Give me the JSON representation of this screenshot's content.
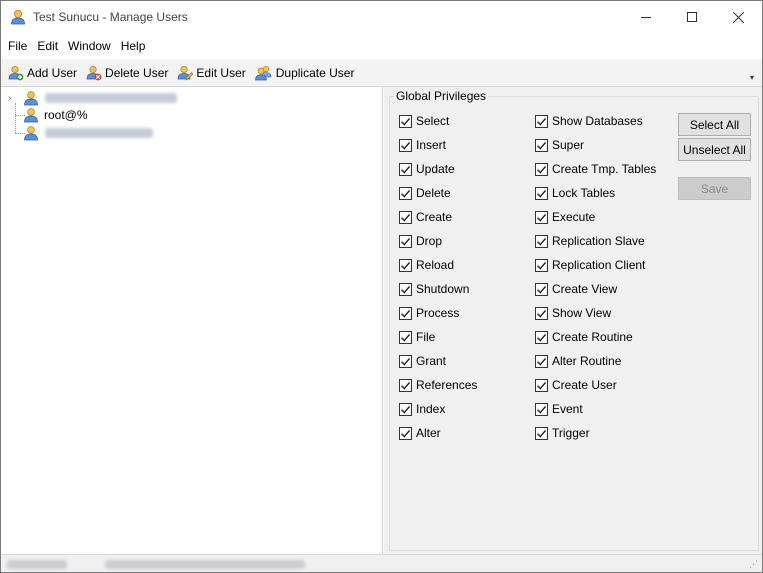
{
  "window": {
    "title": "Test Sunucu - Manage Users",
    "controls": {
      "minimize": "minimize",
      "maximize": "maximize",
      "close": "close"
    }
  },
  "menu": [
    "File",
    "Edit",
    "Window",
    "Help"
  ],
  "toolbar": {
    "add_user": "Add User",
    "delete_user": "Delete User",
    "edit_user": "Edit User",
    "duplicate_user": "Duplicate User"
  },
  "tree": {
    "users": [
      {
        "label": "",
        "redacted": true
      },
      {
        "label": "root@%",
        "redacted": false
      },
      {
        "label": "",
        "redacted": true
      }
    ]
  },
  "privileges": {
    "group_title": "Global Privileges",
    "left_column": [
      "Select",
      "Insert",
      "Update",
      "Delete",
      "Create",
      "Drop",
      "Reload",
      "Shutdown",
      "Process",
      "File",
      "Grant",
      "References",
      "Index",
      "Alter"
    ],
    "right_column": [
      "Show Databases",
      "Super",
      "Create Tmp. Tables",
      "Lock Tables",
      "Execute",
      "Replication Slave",
      "Replication Client",
      "Create View",
      "Show View",
      "Create Routine",
      "Alter Routine",
      "Create User",
      "Event",
      "Trigger"
    ],
    "all_checked": true
  },
  "buttons": {
    "select_all": "Select All",
    "unselect_all": "Unselect All",
    "save": "Save"
  }
}
